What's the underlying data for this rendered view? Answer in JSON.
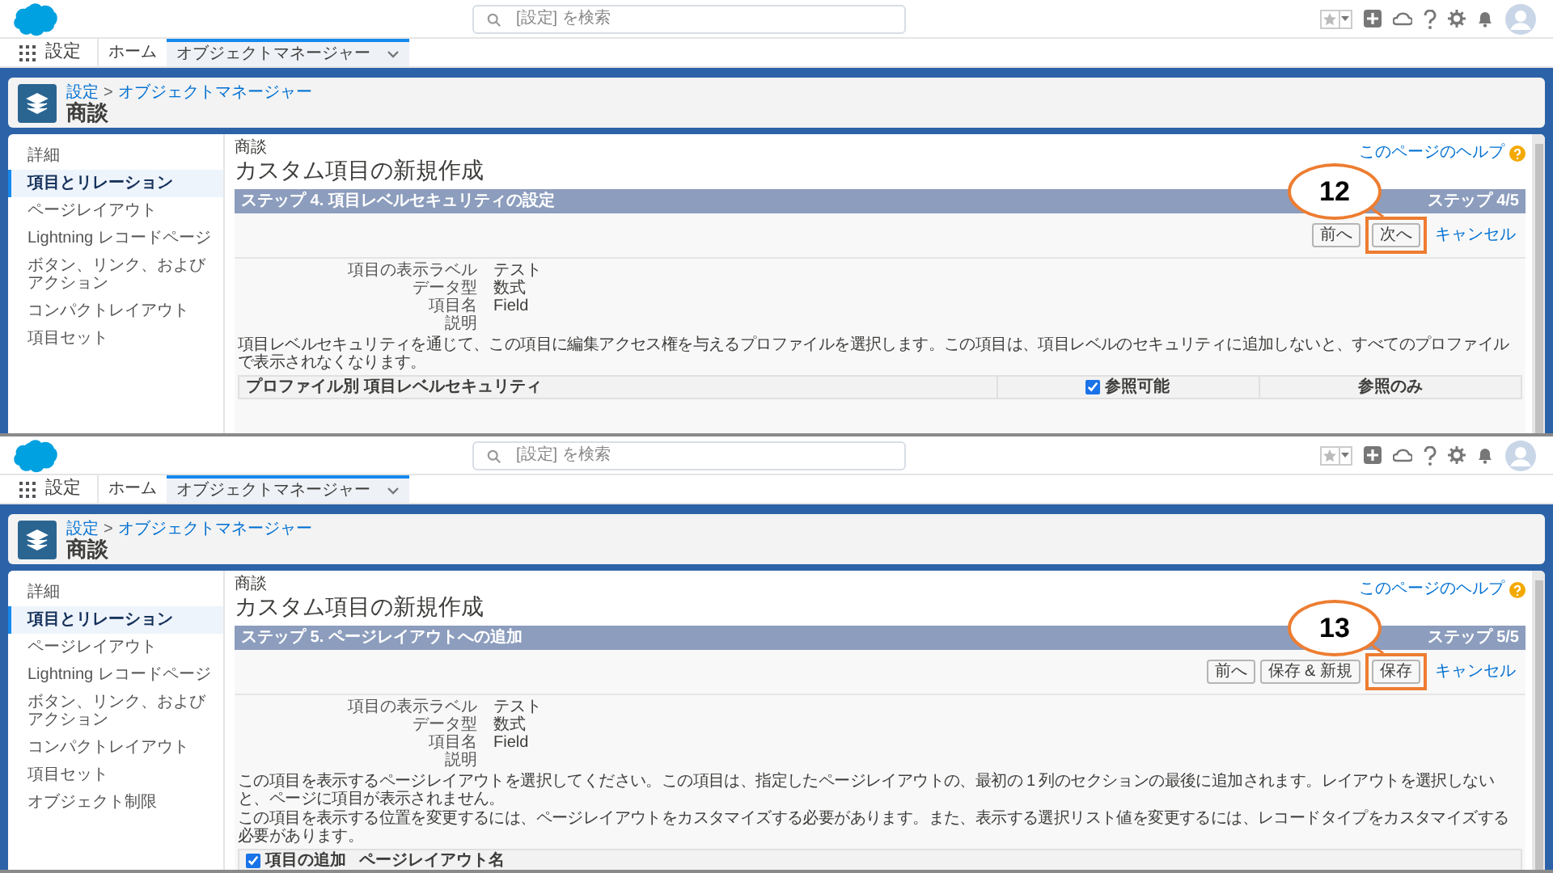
{
  "screens": [
    {
      "search": {
        "placeholder": "[設定] を検索"
      },
      "app_name": "設定",
      "nav_tabs": [
        {
          "label": "ホーム",
          "selected": false
        },
        {
          "label": "オブジェクトマネージャー",
          "selected": true
        }
      ],
      "breadcrumb": {
        "items": [
          "設定",
          "オブジェクトマネージャー"
        ],
        "separator": ">"
      },
      "object_title": "商談",
      "sidebar": [
        {
          "label": "詳細",
          "selected": false
        },
        {
          "label": "項目とリレーション",
          "selected": true
        },
        {
          "label": "ページレイアウト",
          "selected": false
        },
        {
          "label": "Lightning レコードページ",
          "selected": false
        },
        {
          "label": "ボタン、リンク、およびアクション",
          "selected": false
        },
        {
          "label": "コンパクトレイアウト",
          "selected": false
        },
        {
          "label": "項目セット",
          "selected": false
        }
      ],
      "page_label": "商談",
      "page_title": "カスタム項目の新規作成",
      "help_link": "このページのヘルプ",
      "step": {
        "title": "ステップ 4. 項目レベルセキュリティの設定",
        "count": "ステップ 4/5"
      },
      "buttons": [
        {
          "label": "前へ",
          "highlighted": false
        },
        {
          "label": "次へ",
          "highlighted": true
        }
      ],
      "cancel_link": "キャンセル",
      "details": [
        {
          "label": "項目の表示ラベル",
          "value": "テスト"
        },
        {
          "label": "データ型",
          "value": "数式"
        },
        {
          "label": "項目名",
          "value": "Field"
        },
        {
          "label": "説明"
        }
      ],
      "notes": [
        "項目レベルセキュリティを通じて、この項目に編集アクセス権を与えるプロファイルを選択します。この項目は、項目レベルのセキュリティに追加しないと、すべてのプロファイルで表示されなくなります。"
      ],
      "table_header": [
        {
          "kind": "text",
          "label": "プロファイル別 項目レベルセキュリティ"
        },
        {
          "kind": "checkbox",
          "label": "参照可能",
          "checked": true
        },
        {
          "kind": "text",
          "label": "参照のみ"
        }
      ],
      "callout": "12"
    },
    {
      "search": {
        "placeholder": "[設定] を検索"
      },
      "app_name": "設定",
      "nav_tabs": [
        {
          "label": "ホーム",
          "selected": false
        },
        {
          "label": "オブジェクトマネージャー",
          "selected": true
        }
      ],
      "breadcrumb": {
        "items": [
          "設定",
          "オブジェクトマネージャー"
        ],
        "separator": ">"
      },
      "object_title": "商談",
      "sidebar": [
        {
          "label": "詳細",
          "selected": false
        },
        {
          "label": "項目とリレーション",
          "selected": true
        },
        {
          "label": "ページレイアウト",
          "selected": false
        },
        {
          "label": "Lightning レコードページ",
          "selected": false
        },
        {
          "label": "ボタン、リンク、およびアクション",
          "selected": false
        },
        {
          "label": "コンパクトレイアウト",
          "selected": false
        },
        {
          "label": "項目セット",
          "selected": false
        },
        {
          "label": "オブジェクト制限",
          "selected": false
        }
      ],
      "page_label": "商談",
      "page_title": "カスタム項目の新規作成",
      "help_link": "このページのヘルプ",
      "step": {
        "title": "ステップ 5. ページレイアウトへの追加",
        "count": "ステップ 5/5"
      },
      "buttons": [
        {
          "label": "前へ",
          "highlighted": false
        },
        {
          "label": "保存 & 新規",
          "highlighted": false
        },
        {
          "label": "保存",
          "highlighted": true
        }
      ],
      "cancel_link": "キャンセル",
      "details": [
        {
          "label": "項目の表示ラベル",
          "value": "テスト"
        },
        {
          "label": "データ型",
          "value": "数式"
        },
        {
          "label": "項目名",
          "value": "Field"
        },
        {
          "label": "説明"
        }
      ],
      "notes": [
        "この項目を表示するページレイアウトを選択してください。この項目は、指定したページレイアウトの、最初の 1 列のセクションの最後に追加されます。レイアウトを選択しないと、ページに項目が表示されません。",
        "この項目を表示する位置を変更するには、ページレイアウトをカスタマイズする必要があります。また、表示する選択リスト値を変更するには、レコードタイプをカスタマイズする必要があります。"
      ],
      "table_header": [
        {
          "kind": "checkbox",
          "label": "項目の追加",
          "checked": true
        },
        {
          "kind": "text",
          "label": "ページレイアウト名"
        }
      ],
      "callout": "13"
    }
  ]
}
